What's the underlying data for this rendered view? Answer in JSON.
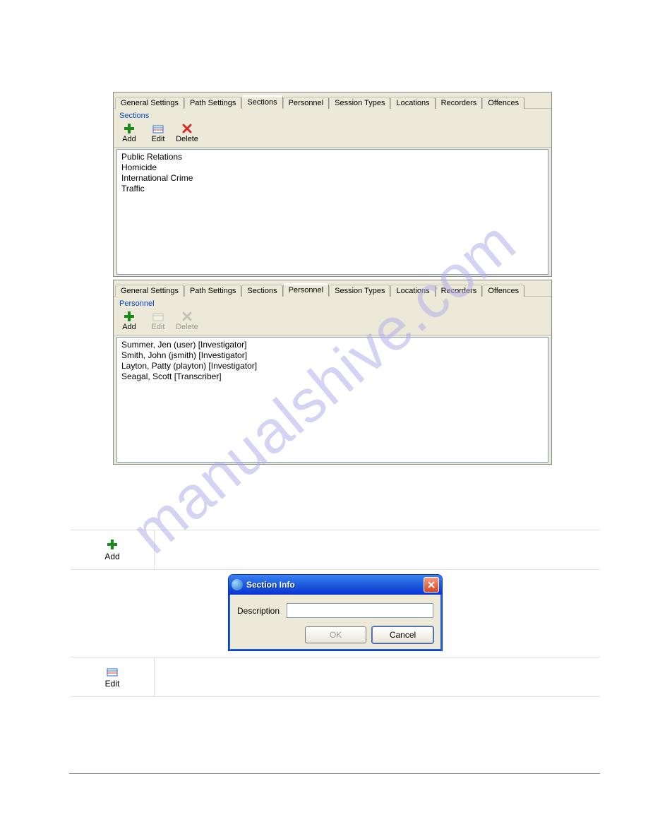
{
  "watermark": "manualshive.com",
  "panel1": {
    "tabs": [
      "General Settings",
      "Path Settings",
      "Sections",
      "Personnel",
      "Session Types",
      "Locations",
      "Recorders",
      "Offences"
    ],
    "active_index": 2,
    "group_label": "Sections",
    "toolbar": {
      "add": "Add",
      "edit": "Edit",
      "delete": "Delete"
    },
    "items": [
      "Public Relations",
      "Homicide",
      "International Crime",
      "Traffic"
    ]
  },
  "panel2": {
    "tabs": [
      "General Settings",
      "Path Settings",
      "Sections",
      "Personnel",
      "Session Types",
      "Locations",
      "Recorders",
      "Offences"
    ],
    "active_index": 3,
    "group_label": "Personnel",
    "toolbar": {
      "add": "Add",
      "edit": "Edit",
      "delete": "Delete"
    },
    "items": [
      "Summer, Jen (user)  [Investigator]",
      "Smith, John (jsmith)  [Investigator]",
      "Layton, Patty (playton)  [Investigator]",
      "Seagal, Scott  [Transcriber]"
    ]
  },
  "rows": {
    "add_label": "Add",
    "edit_label": "Edit"
  },
  "dialog": {
    "title": "Section Info",
    "desc_label": "Description",
    "desc_value": "",
    "ok": "OK",
    "cancel": "Cancel"
  }
}
